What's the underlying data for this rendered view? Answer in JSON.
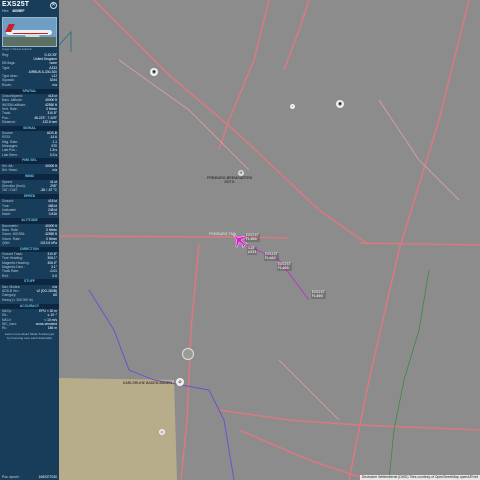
{
  "aircraft": {
    "title": "EXS25T",
    "hex_label": "Hex:",
    "hex": "4005EF",
    "photo_caption": "Image © Manuel Kolesnik"
  },
  "info_rows": [
    {
      "k": "Reg:",
      "v": "G-DCSF"
    },
    {
      "k": "",
      "v": "United Kingdom"
    },
    {
      "k": "DB flags:",
      "v": "none"
    },
    {
      "k": "Type:",
      "v": "A333"
    },
    {
      "k": "",
      "v": "AIRBUS A-330-300"
    },
    {
      "k": "Type desc.:",
      "v": "L2J"
    },
    {
      "k": "Squawk:",
      "v": "3244"
    },
    {
      "k": "Route:",
      "v": "n/a"
    }
  ],
  "sections": {
    "spatial": "SPATIAL",
    "signal": "SIGNAL",
    "fms": "FMS SEL",
    "wind": "WIND",
    "speed": "SPEED",
    "altitude": "ALTITUDE",
    "direction": "DIRECTION",
    "stuff": "STUFF",
    "accuracy": "ACCURACY"
  },
  "spatial_rows": [
    {
      "k": "Groundspeed:",
      "v": "418 kt"
    },
    {
      "k": "Baro. Altitude:",
      "v": "40000 ft"
    },
    {
      "k": "WGS84 altitude:",
      "v": "42550 ft"
    },
    {
      "k": "Vert. Rate:",
      "v": "0 ft/min"
    },
    {
      "k": "Track:",
      "v": "310.8°"
    },
    {
      "k": "Pos.:",
      "v": "48.223°, 7.429°"
    },
    {
      "k": "Distance:",
      "v": "132.6 nmi"
    }
  ],
  "signal_rows": [
    {
      "k": "Source:",
      "v": "ADS-B"
    },
    {
      "k": "RSSI:",
      "v": "-14.6"
    },
    {
      "k": "Msg. Rate:",
      "v": "1.1"
    },
    {
      "k": "Messages:",
      "v": "670"
    },
    {
      "k": "Last Pos.:",
      "v": "1.8 s"
    },
    {
      "k": "Last Seen:",
      "v": "0.3 s"
    }
  ],
  "fms_rows": [
    {
      "k": "Sel. Alt.:",
      "v": "40000 ft"
    },
    {
      "k": "Sel. Head.:",
      "v": "n/a"
    }
  ],
  "wind_rows": [
    {
      "k": "Speed:",
      "v": "41 kt"
    },
    {
      "k": "Direction (from):",
      "v": "298°"
    },
    {
      "k": "TAT / OAT:",
      "v": "-36 / -57 °C"
    }
  ],
  "speed_rows": [
    {
      "k": "Ground:",
      "v": "418 kt"
    },
    {
      "k": "True:",
      "v": "468 kt"
    },
    {
      "k": "Indicated:",
      "v": "248 kt"
    },
    {
      "k": "Mach:",
      "v": "0.816"
    }
  ],
  "altitude_rows": [
    {
      "k": "Barometric:",
      "v": "40000 ft"
    },
    {
      "k": "Baro. Rate:",
      "v": "0 ft/min"
    },
    {
      "k": "Geom. WGS84:",
      "v": "42550 ft"
    },
    {
      "k": "Geom. Rate:",
      "v": "0 ft/min"
    },
    {
      "k": "QNH:",
      "v": "1013.6 hPa"
    }
  ],
  "direction_rows": [
    {
      "k": "Ground Track:",
      "v": "310.8°"
    },
    {
      "k": "True Heading:",
      "v": "306.1°"
    },
    {
      "k": "Magnetic Heading:",
      "v": "306.0°"
    },
    {
      "k": "Magnetic Decl.:",
      "v": "3.1°"
    },
    {
      "k": "Track Rate:",
      "v": "-0.01"
    },
    {
      "k": "Roll:",
      "v": "0.0"
    }
  ],
  "stuff_rows": [
    {
      "k": "Nav. Modes:",
      "v": "n/a"
    },
    {
      "k": "ADS-B Ver.:",
      "v": "v2 (DO-260B)"
    },
    {
      "k": "Category:",
      "v": "A5"
    },
    {
      "k": "Heavy (> 300 000 lb)",
      "v": ""
    }
  ],
  "accuracy_rows": [
    {
      "k": "NACp:",
      "v": "EPU < 30 m"
    },
    {
      "k": "SIL:",
      "v": "≤ 10⁻⁷"
    },
    {
      "k": "NACv:",
      "v": "< 10 m/s"
    },
    {
      "k": "NIC_baro:",
      "v": "cross-checked"
    },
    {
      "k": "Rc:",
      "v": "186 m"
    }
  ],
  "note": "Learn more about Mode S data type by hovering over each data label",
  "footer": {
    "k": "Pos. epoch:",
    "v": "1692377020"
  },
  "map_labels": {
    "airfield_mid": "FREIBURG-BREMGARTEN",
    "airfield_mid_sub": "EDTG",
    "sector_line": "FREIBURG TMA",
    "airfield_low": "KARLSRUHE BADEN-BADEN",
    "attribution": "Deutscher Wetterdienst (DWD) Tiles courtesy of OpenStreetMap openAIP.net"
  },
  "aircraft_label": {
    "callsign": "EXS25T",
    "alt": "FL400",
    "speed": "418",
    "type": "A333"
  },
  "trail_labels": [
    {
      "l1": "EXS25T",
      "l2": "FL400"
    },
    {
      "l1": "EXS25T",
      "l2": "FL400"
    },
    {
      "l1": "EXS25T",
      "l2": "FL400"
    }
  ],
  "colors": {
    "sidebar_bg": "#183d5a",
    "section_accent": "#67c5ea",
    "map_bg": "#8c8c8c",
    "road": "#d87a80",
    "airspace": "#6a4bd6",
    "trail": "#c130c9",
    "aircraft": "#e21ad5"
  }
}
